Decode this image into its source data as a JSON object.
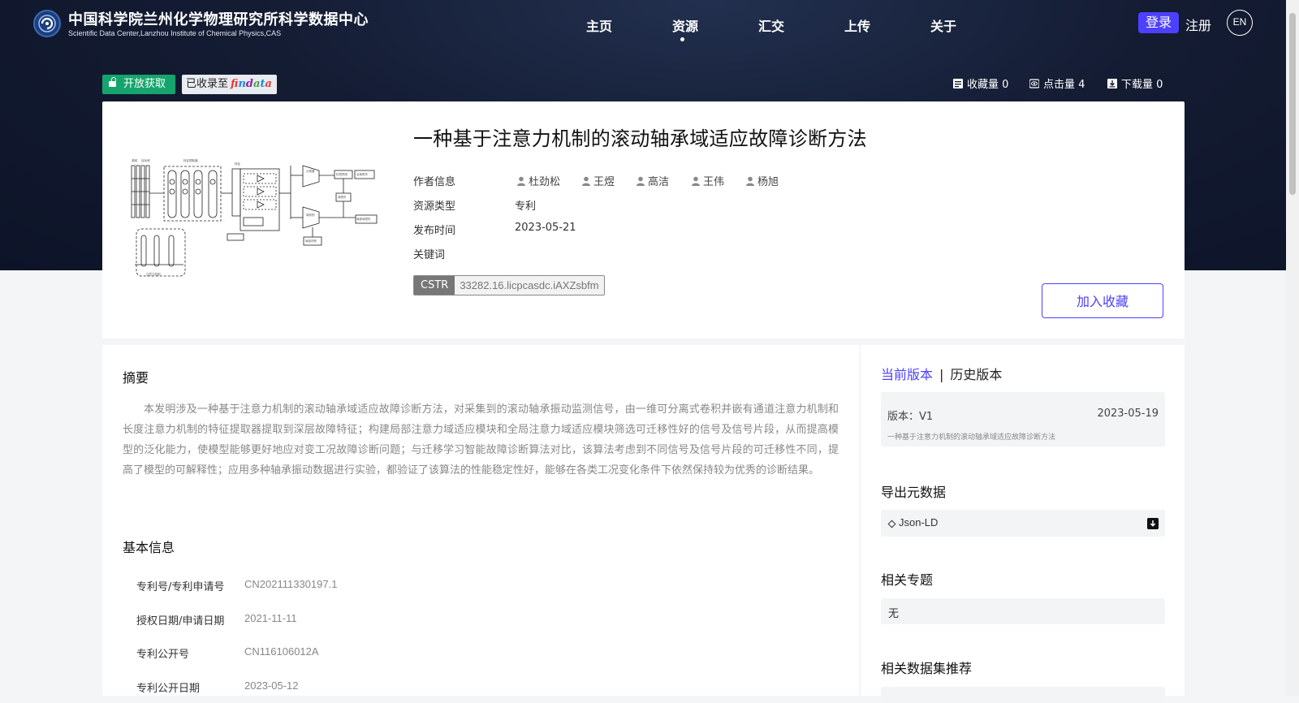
{
  "header": {
    "org_name_cn": "中国科学院兰州化学物理研究所科学数据中心",
    "org_name_en": "Scientific Data Center,Lanzhou Institute of Chemical Physics,CAS",
    "nav": [
      "主页",
      "资源",
      "汇交",
      "上传",
      "关于"
    ],
    "active_nav": "资源",
    "login_label": "登录",
    "register_label": "注册",
    "lang_label": "EN"
  },
  "badges": {
    "open_access": "开放获取",
    "collected_prefix": "已收录至",
    "findata_logo": "findata"
  },
  "stats": {
    "favorites": "收藏量 0",
    "clicks": "点击量 4",
    "downloads": "下载量 0"
  },
  "resource": {
    "title": "一种基于注意力机制的滚动轴承域适应故障诊断方法",
    "labels": {
      "authors": "作者信息",
      "type": "资源类型",
      "published": "发布时间",
      "keywords": "关键词"
    },
    "authors": [
      "杜劲松",
      "王煜",
      "高洁",
      "王伟",
      "杨旭"
    ],
    "type": "专利",
    "published": "2023-05-21",
    "keywords": "",
    "cstr_label": "CSTR",
    "cstr_value": "33282.16.licpcasdc.iAXZsbfm",
    "add_favorite_label": "加入收藏"
  },
  "abstract": {
    "heading": "摘要",
    "text": "本发明涉及一种基于注意力机制的滚动轴承域适应故障诊断方法，对采集到的滚动轴承振动监测信号，由一维可分离式卷积并嵌有通道注意力机制和长度注意力机制的特征提取器提取到深层故障特征；构建局部注意力域适应模块和全局注意力域适应模块筛选可迁移性好的信号及信号片段，从而提高模型的泛化能力，使模型能够更好地应对变工况故障诊断问题；与迁移学习智能故障诊断算法对比，该算法考虑到不同信号及信号片段的可迁移性不同，提高了模型的可解释性；应用多种轴承振动数据进行实验，都验证了该算法的性能稳定性好，能够在各类工况变化条件下依然保持较为优秀的诊断结果。"
  },
  "basic_info": {
    "heading": "基本信息",
    "rows": [
      {
        "label": "专利号/专利申请号",
        "value": "CN202111330197.1"
      },
      {
        "label": "授权日期/申请日期",
        "value": "2021-11-11"
      },
      {
        "label": "专利公开号",
        "value": "CN116106012A"
      },
      {
        "label": "专利公开日期",
        "value": "2023-05-12"
      }
    ]
  },
  "sidebar": {
    "tab_current": "当前版本",
    "tab_separator": "|",
    "tab_history": "历史版本",
    "version_label": "版本：V1",
    "version_date": "2023-05-19",
    "version_name": "一种基于注意力机制的滚动轴承域适应故障诊断方法",
    "export_heading": "导出元数据",
    "export_format": "Json-LD",
    "topics_heading": "相关专题",
    "topics_value": "无",
    "recommend_heading": "相关数据集推荐"
  },
  "colors": {
    "accent": "#4d40ff",
    "open_badge": "#16a46e",
    "hero_bg": "#141c33"
  }
}
